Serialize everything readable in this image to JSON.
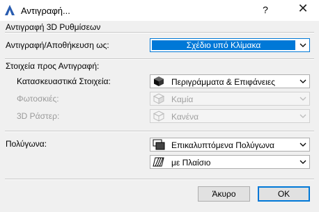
{
  "window": {
    "title": "Αντιγραφή...",
    "help_label": "?",
    "close_label": "✕"
  },
  "section_3d": {
    "header": "Αντιγραφή 3D Ρυθμίσεων",
    "save_as_label": "Αντιγραφή/Αποθήκευση ως:",
    "save_as_value": "Σχέδιο υπό Κλίμακα"
  },
  "section_elements": {
    "header": "Στοιχεία προς Αντιγραφή:",
    "rows": [
      {
        "label": "Κατασκευαστικά Στοιχεία:",
        "value": "Περιγράμματα & Επιφάνειες",
        "icon": "cube-solid-icon",
        "enabled": true
      },
      {
        "label": "Φωτοσκιές:",
        "value": "Καμία",
        "icon": "cube-shadow-icon",
        "enabled": false
      },
      {
        "label": "3D Ράστερ:",
        "value": "Κανένα",
        "icon": "cube-wireframe-icon",
        "enabled": false
      }
    ]
  },
  "section_polygons": {
    "label": "Πολύγωνα:",
    "polygon_value": "Επικαλυπτόμενα Πολύγωνα",
    "polygon_icon": "overlapping-polygons-icon",
    "frame_value": "με Πλαίσιο",
    "frame_icon": "hatched-frame-icon"
  },
  "buttons": {
    "cancel": "Άκυρο",
    "ok": "OK"
  },
  "colors": {
    "accent": "#0078d7",
    "dialog_bg": "#f0f0f0",
    "disabled_text": "#9a9a9a"
  }
}
